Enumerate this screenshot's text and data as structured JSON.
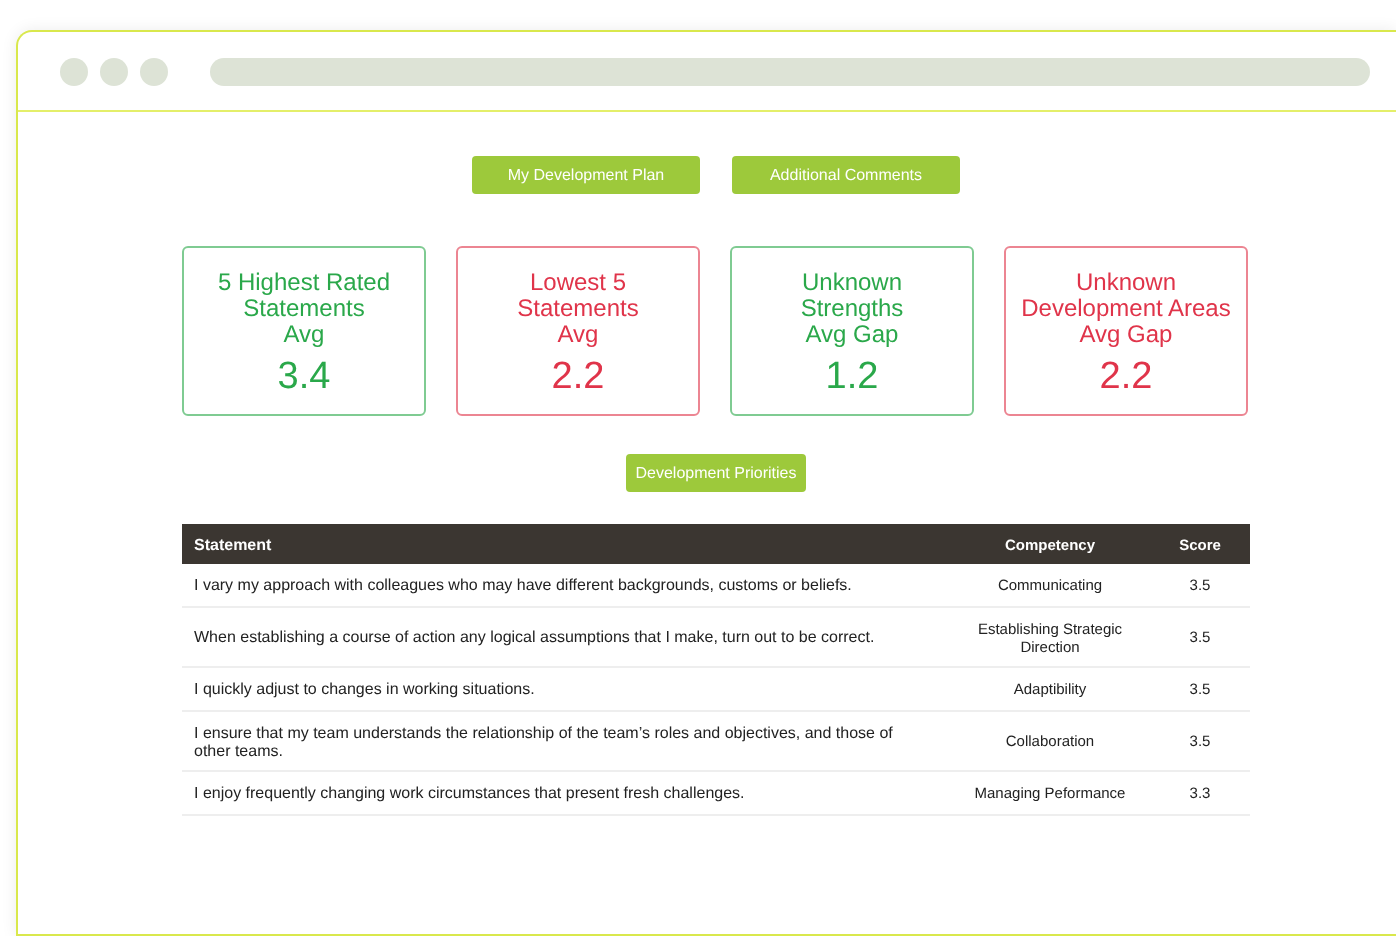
{
  "top_buttons": [
    "My Development Plan",
    "Additional Comments"
  ],
  "cards": [
    {
      "title": "5 Highest Rated\nStatements\nAvg",
      "value": "3.4",
      "color": "#2aa84a"
    },
    {
      "title": "Lowest 5\nStatements\nAvg",
      "value": "2.2",
      "color": "#e0344a"
    },
    {
      "title": "Unknown\nStrengths\nAvg Gap",
      "value": "1.2",
      "color": "#2aa84a"
    },
    {
      "title": "Unknown\nDevelopment Areas\nAvg Gap",
      "value": "2.2",
      "color": "#e0344a"
    }
  ],
  "priorities_button": "Development Priorities",
  "table": {
    "columns": [
      "Statement",
      "Competency",
      "Score"
    ],
    "rows": [
      [
        "I vary my approach with colleagues who may have different backgrounds, customs or beliefs.",
        "Communicating",
        "3.5"
      ],
      [
        "When establishing a course of action any logical assumptions that I make, turn out to be correct.",
        "Establishing Strategic Direction",
        "3.5"
      ],
      [
        "I quickly adjust to changes in working situations.",
        "Adaptibility",
        "3.5"
      ],
      [
        "I ensure that my team understands the relationship of the team’s roles and objectives, and those of other teams.",
        "Collaboration",
        "3.5"
      ],
      [
        "I enjoy frequently changing work circumstances that present fresh challenges.",
        "Managing Peformance",
        "3.3"
      ]
    ]
  }
}
